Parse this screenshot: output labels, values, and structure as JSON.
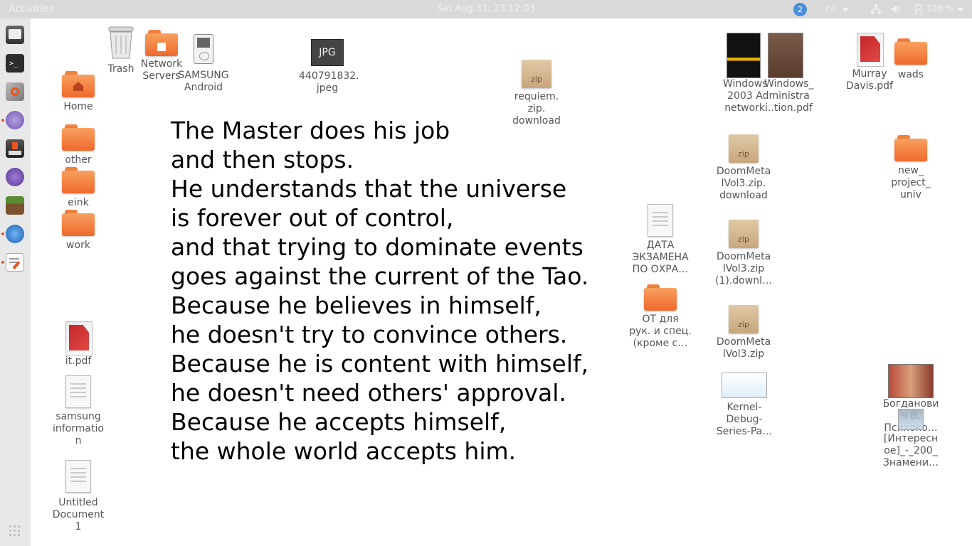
{
  "topbar": {
    "activities": "Activities",
    "clock": "Sat Aug 31, 23:12:03",
    "notification_count": "2",
    "language": "ru",
    "battery": "100 %"
  },
  "dock": {
    "items": [
      {
        "name": "files-app-icon"
      },
      {
        "name": "terminal-icon"
      },
      {
        "name": "settings-icon"
      },
      {
        "name": "pidgin-icon"
      },
      {
        "name": "installer-icon"
      },
      {
        "name": "messenger-icon"
      },
      {
        "name": "minecraft-icon"
      },
      {
        "name": "thunderbird-icon"
      },
      {
        "name": "text-editor-icon"
      }
    ]
  },
  "desktop": {
    "trash": "Trash",
    "network": "Network\nServers",
    "samsung": "SAMSUNG\nAndroid",
    "jpeg_badge": "JPG",
    "jpeg": "440791832.\njpeg",
    "requiem": "requiem.\nzip.\ndownload",
    "home": "Home",
    "other": "other",
    "eink": "eink",
    "work": "work",
    "itpdf": "it.pdf",
    "samsung_info": "samsung\ninformatio\nn",
    "untitled": "Untitled\nDocument\n1",
    "windows1": "Windows",
    "windows2": "Windows_",
    "windows_line2": "2003 Administra",
    "windows_line3": "networki..tion.pdf",
    "murray": "Murray\nDavis.pdf",
    "wads": "wads",
    "doom1": "DoomMeta\nlVol3.zip.\ndownload",
    "doom2": "DoomMeta\nlVol3.zip\n(1).downl…",
    "doom3": "DoomMeta\nlVol3.zip",
    "new_project": "new_\nproject_\nuniv",
    "data_exam": "ДАТА\nЭКЗАМЕНА\nПО ОХРА…",
    "ot": "ОТ для\nрук. и спец.\n(кроме с…",
    "kernel": "Kernel-\nDebug-\nSeries-Pa…",
    "bogdan": "Богданови\nч В.\nПсихоко…",
    "interesting": "[Интересн\nое]_-_200_\nЗнамени…",
    "zip_badge": "zip"
  },
  "poem": [
    "The Master does his job",
    "and then stops.",
    "He understands that the universe",
    "is forever out of control,",
    "and that trying to dominate events",
    "goes against the current of the Tao.",
    "Because he believes in himself,",
    "he doesn't try to convince others.",
    "Because he is content with himself,",
    "he doesn't need others' approval.",
    "Because he accepts himself,",
    "the whole world accepts him."
  ]
}
